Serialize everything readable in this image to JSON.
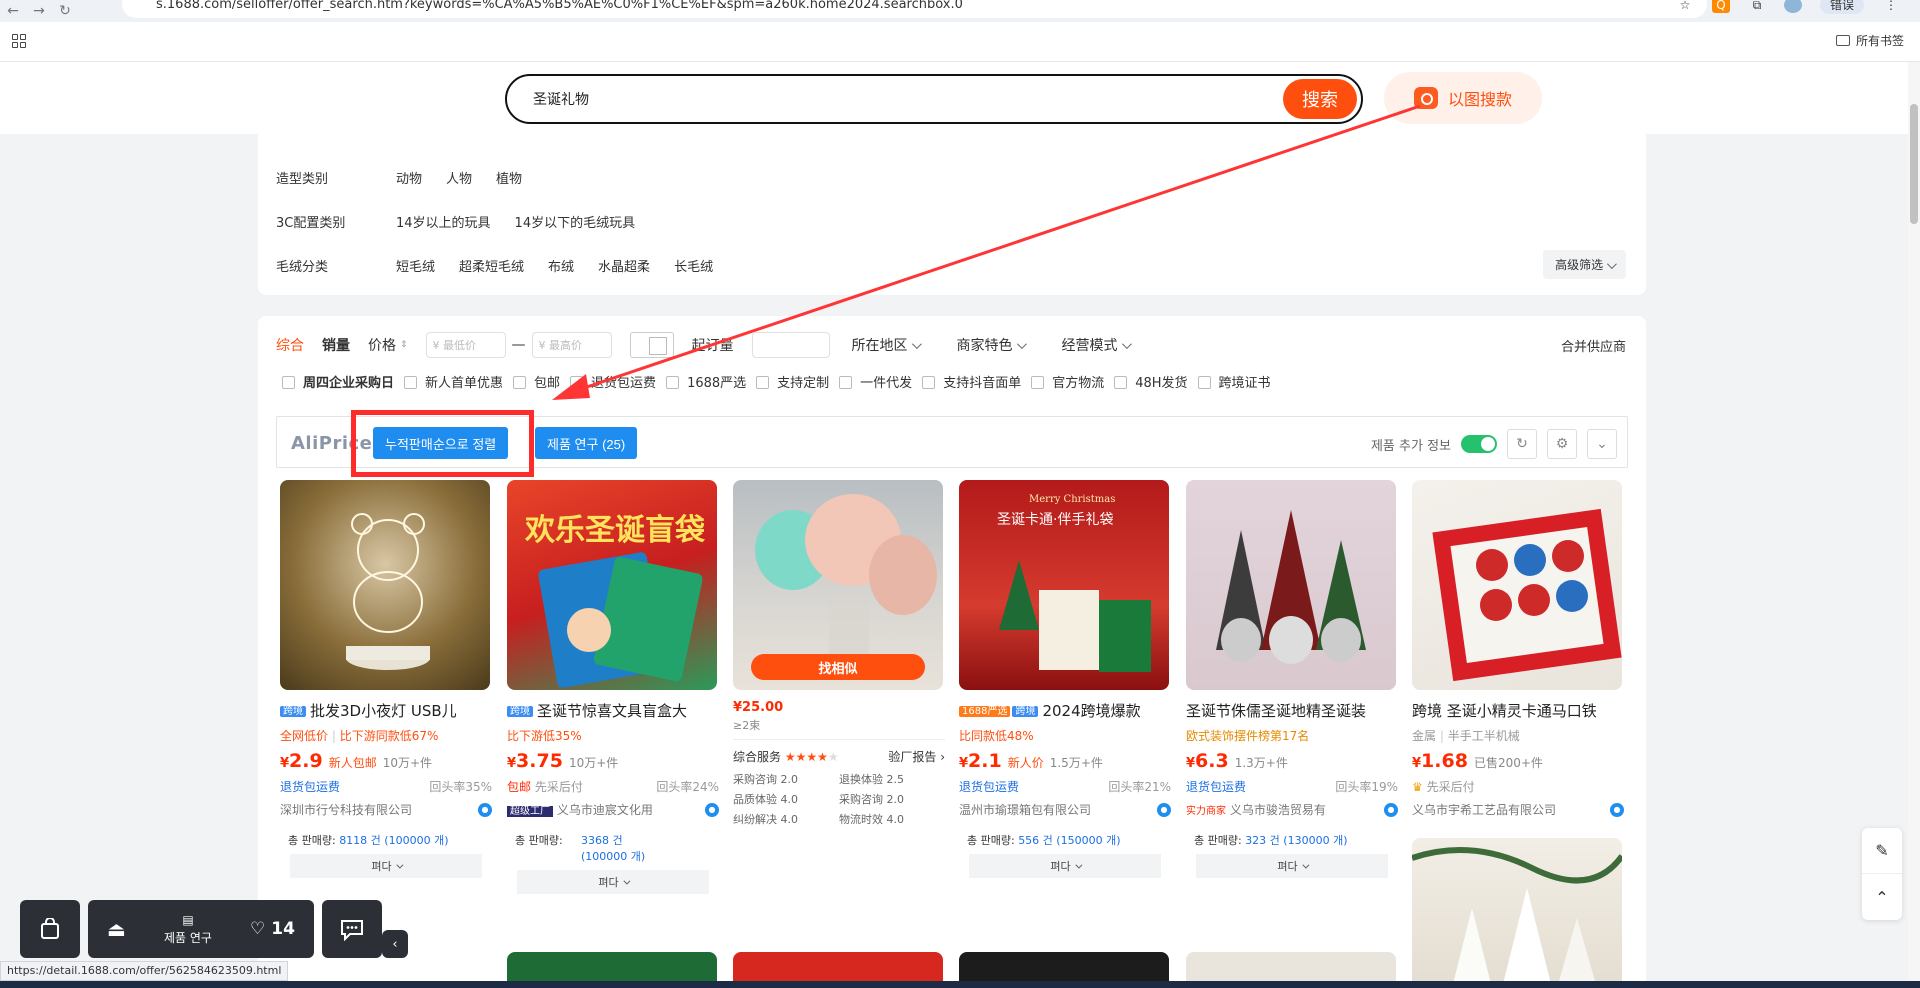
{
  "browser": {
    "url": "s.1688.com/selloffer/offer_search.htm?keywords=%CA%A5%B5%AE%C0%F1%CE%EF&spm=a260k.home2024.searchbox.0",
    "profile_label": "错误",
    "all_bookmarks": "所有书签",
    "status_url": "https://detail.1688.com/offer/562584623509.html"
  },
  "search": {
    "query": "圣诞礼物",
    "button_label": "搜索",
    "image_search_label": "以图搜款"
  },
  "filters": {
    "rows": [
      {
        "name": "造型类别",
        "options": [
          "动物",
          "人物",
          "植物"
        ]
      },
      {
        "name": "3C配置类别",
        "options": [
          "14岁以上的玩具",
          "14岁以下的毛绒玩具"
        ]
      },
      {
        "name": "毛绒分类",
        "options": [
          "短毛绒",
          "超柔短毛绒",
          "布绒",
          "水晶超柔",
          "长毛绒"
        ]
      }
    ],
    "advanced": "高级筛选"
  },
  "sort": {
    "comprehensive": "综合",
    "sales": "销量",
    "price": "价格",
    "min_price_ph": "¥ 最低价",
    "max_price_ph": "¥ 最高价",
    "dash": "—",
    "start_qty": "起订量",
    "region": "所在地区",
    "merchant_feature": "商家特色",
    "business_mode": "经营模式",
    "merge_suppliers": "合并供应商"
  },
  "checkboxes": [
    "周四企业采购日",
    "新人首单优惠",
    "包邮",
    "退货包运费",
    "1688严选",
    "支持定制",
    "一件代发",
    "支持抖音面单",
    "官方物流",
    "48H发货",
    "跨境证书"
  ],
  "aliprice": {
    "logo": "AliPrice",
    "sort_btn": "누적판매순으로 정렬",
    "research_btn": "제품 연구 (25)",
    "extra_info": "제품 추가 정보"
  },
  "products": [
    {
      "tag": "跨境",
      "title": "批发3D小夜灯 USB儿",
      "line2a": "全网低价",
      "line2b": "比下游同款低67%",
      "price_int": "2.9",
      "promo": "新人包邮",
      "sold": "10万+件",
      "return": "退货包运费",
      "repeat": "回头率35%",
      "company": "深圳市行兮科技有限公司",
      "sales_label": "총 판매량:",
      "sales": "8118 건 (100000 개)",
      "fold": "펴다"
    },
    {
      "tag": "跨境",
      "title": "圣诞节惊喜文具盲盒大",
      "line2a": "",
      "line2b": "比下游低35%",
      "price_int": "3.75",
      "promo": "",
      "sold": "10万+件",
      "return_red": "包邮",
      "return": "先采后付",
      "repeat": "回头率24%",
      "badge": "超级工厂",
      "company": "义乌市迪宸文化用",
      "sales_label": "총 판매량:",
      "sales": "3368 건 (100000 개)",
      "fold": "펴다"
    },
    {
      "find_similar": "找相似",
      "price": "¥25.00",
      "moq": "≥2束",
      "service": "综合服务",
      "report": "验厂报告",
      "metrics": [
        [
          "采购咨询",
          "2.0"
        ],
        [
          "退换体验",
          "2.5"
        ],
        [
          "品质体验",
          "4.0"
        ],
        [
          "采购咨询",
          "2.0"
        ],
        [
          "纠纷解决",
          "4.0"
        ],
        [
          "物流时效",
          "4.0"
        ]
      ]
    },
    {
      "tag_yx": "1688严选",
      "tag": "跨境",
      "title": "2024跨境爆款",
      "line2a": "",
      "line2b": "比同款低48%",
      "price_int": "2.1",
      "promo": "新人价",
      "sold": "1.5万+件",
      "return": "退货包运费",
      "repeat": "回头率21%",
      "company": "温州市瑜璟箱包有限公司",
      "sales_label": "총 판매량:",
      "sales": "556 건 (150000 개)",
      "fold": "펴다"
    },
    {
      "title": "圣诞节侏儒圣诞地精圣诞装",
      "line2_orange": "欧式装饰摆件榜第17名",
      "price_int": "6.3",
      "promo": "",
      "sold": "1.3万+件",
      "return": "退货包运费",
      "repeat": "回头率19%",
      "badge2": "实力商家",
      "company": "义乌市骏浩贸易有",
      "sales_label": "총 판매량:",
      "sales": "323 건 (130000 개)",
      "fold": "펴다"
    },
    {
      "title": "跨境 圣诞小精灵卡通马口铁",
      "line2_gray": "金属",
      "line2_gray2": "半手工半机械",
      "price_int": "1.68",
      "promo": "",
      "sold": "已售200+件",
      "return_gray": "先采后付",
      "company": "义乌市宇希工艺品有限公司"
    }
  ],
  "float_bar": {
    "research": "제품 연구",
    "likes": "14"
  },
  "colors": {
    "accent": "#ff4f0f",
    "aliprice_blue": "#1f8cf0",
    "annotation_red": "#ff2b2b"
  }
}
